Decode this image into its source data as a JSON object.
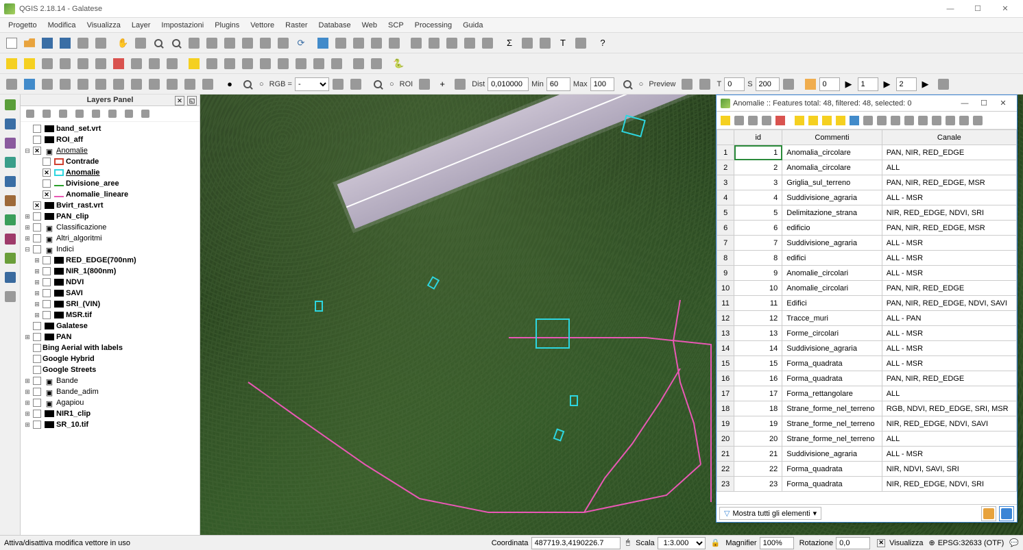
{
  "window": {
    "title": "QGIS 2.18.14 - Galatese"
  },
  "menu": [
    "Progetto",
    "Modifica",
    "Visualizza",
    "Layer",
    "Impostazioni",
    "Plugins",
    "Vettore",
    "Raster",
    "Database",
    "Web",
    "SCP",
    "Processing",
    "Guida"
  ],
  "toolbar3": {
    "rgb_label": "RGB =",
    "rgb_value": "-",
    "roi_label": "ROI",
    "dist_label": "Dist",
    "dist_value": "0,010000",
    "min_label": "Min",
    "min_value": "60",
    "max_label": "Max",
    "max_value": "100",
    "preview_label": "Preview",
    "t_label": "T",
    "t_value": "0",
    "s_label": "S",
    "s_value": "200",
    "grid1_value": "0",
    "grid2_value": "1",
    "grid3_value": "2"
  },
  "layers_panel": {
    "title": "Layers Panel",
    "items": [
      {
        "level": 0,
        "exp": "",
        "checked": false,
        "sym": "#000",
        "label": "band_set.vrt",
        "bold": true
      },
      {
        "level": 0,
        "exp": "",
        "checked": false,
        "sym": "#000",
        "label": "ROI_aff",
        "bold": true
      },
      {
        "level": 0,
        "exp": "-",
        "checked": true,
        "sym": "group",
        "label": "Anomalie",
        "bold": false,
        "under": true
      },
      {
        "level": 1,
        "exp": "",
        "checked": false,
        "sym": "#d04030",
        "label": "Contrade",
        "bold": true,
        "outline": true
      },
      {
        "level": 1,
        "exp": "",
        "checked": true,
        "sym": "#2dd6e0",
        "label": "Anomalie",
        "bold": true,
        "under": true,
        "outline": true
      },
      {
        "level": 1,
        "exp": "",
        "checked": false,
        "sym": "#2aa02a",
        "label": "Divisione_aree",
        "bold": true,
        "line": true
      },
      {
        "level": 1,
        "exp": "",
        "checked": true,
        "sym": "#e958b5",
        "label": "Anomalie_lineare",
        "bold": true,
        "line": true
      },
      {
        "level": 0,
        "exp": "",
        "checked": true,
        "sym": "#000",
        "label": "Bvirt_rast.vrt",
        "bold": true
      },
      {
        "level": 0,
        "exp": "+",
        "checked": false,
        "sym": "#000",
        "label": "PAN_clip",
        "bold": true
      },
      {
        "level": 0,
        "exp": "+",
        "checked": false,
        "sym": "group",
        "label": "Classificazione"
      },
      {
        "level": 0,
        "exp": "+",
        "checked": false,
        "sym": "group",
        "label": "Altri_algoritmi"
      },
      {
        "level": 0,
        "exp": "-",
        "checked": false,
        "sym": "group",
        "label": "Indici"
      },
      {
        "level": 1,
        "exp": "+",
        "checked": false,
        "sym": "#000",
        "label": "RED_EDGE(700nm)",
        "bold": true
      },
      {
        "level": 1,
        "exp": "+",
        "checked": false,
        "sym": "#000",
        "label": "NIR_1(800nm)",
        "bold": true
      },
      {
        "level": 1,
        "exp": "+",
        "checked": false,
        "sym": "#000",
        "label": "NDVI",
        "bold": true
      },
      {
        "level": 1,
        "exp": "+",
        "checked": false,
        "sym": "#000",
        "label": "SAVI",
        "bold": true
      },
      {
        "level": 1,
        "exp": "+",
        "checked": false,
        "sym": "#000",
        "label": "SRI_(VIN)",
        "bold": true
      },
      {
        "level": 1,
        "exp": "+",
        "checked": false,
        "sym": "#000",
        "label": "MSR.tif",
        "bold": true
      },
      {
        "level": 0,
        "exp": "",
        "checked": false,
        "sym": "#000",
        "label": "Galatese",
        "bold": true
      },
      {
        "level": 0,
        "exp": "+",
        "checked": false,
        "sym": "#000",
        "label": "PAN",
        "bold": true
      },
      {
        "level": 0,
        "exp": "",
        "checked": false,
        "sym": "",
        "label": "Bing Aerial with labels",
        "bold": true
      },
      {
        "level": 0,
        "exp": "",
        "checked": false,
        "sym": "",
        "label": "Google Hybrid",
        "bold": true
      },
      {
        "level": 0,
        "exp": "",
        "checked": false,
        "sym": "",
        "label": "Google Streets",
        "bold": true
      },
      {
        "level": 0,
        "exp": "+",
        "checked": false,
        "sym": "group",
        "label": "Bande"
      },
      {
        "level": 0,
        "exp": "+",
        "checked": false,
        "sym": "group",
        "label": "Bande_adim"
      },
      {
        "level": 0,
        "exp": "+",
        "checked": false,
        "sym": "group",
        "label": "Agapiou"
      },
      {
        "level": 0,
        "exp": "+",
        "checked": false,
        "sym": "#000",
        "label": "NIR1_clip",
        "bold": true
      },
      {
        "level": 0,
        "exp": "+",
        "checked": false,
        "sym": "#000",
        "label": "SR_10.tif",
        "bold": true
      }
    ]
  },
  "attr": {
    "title": "Anomalie :: Features total: 48, filtered: 48, selected: 0",
    "columns": [
      "",
      "id",
      "Commenti",
      "Canale"
    ],
    "filter_label": "Mostra tutti gli elementi",
    "rows": [
      {
        "n": 1,
        "id": 1,
        "c": "Anomalia_circolare",
        "k": "PAN, NIR, RED_EDGE"
      },
      {
        "n": 2,
        "id": 2,
        "c": "Anomalia_circolare",
        "k": "ALL"
      },
      {
        "n": 3,
        "id": 3,
        "c": "Griglia_sul_terreno",
        "k": "PAN, NIR, RED_EDGE, MSR"
      },
      {
        "n": 4,
        "id": 4,
        "c": "Suddivisione_agraria",
        "k": "ALL - MSR"
      },
      {
        "n": 5,
        "id": 5,
        "c": "Delimitazione_strana",
        "k": "NIR, RED_EDGE, NDVI, SRI"
      },
      {
        "n": 6,
        "id": 6,
        "c": "edificio",
        "k": "PAN, NIR, RED_EDGE, MSR"
      },
      {
        "n": 7,
        "id": 7,
        "c": "Suddivisione_agraria",
        "k": "ALL - MSR"
      },
      {
        "n": 8,
        "id": 8,
        "c": "edifici",
        "k": "ALL - MSR"
      },
      {
        "n": 9,
        "id": 9,
        "c": "Anomalie_circolari",
        "k": "ALL - MSR"
      },
      {
        "n": 10,
        "id": 10,
        "c": "Anomalie_circolari",
        "k": "PAN, NIR, RED_EDGE"
      },
      {
        "n": 11,
        "id": 11,
        "c": "Edifici",
        "k": "PAN, NIR, RED_EDGE, NDVI, SAVI"
      },
      {
        "n": 12,
        "id": 12,
        "c": "Tracce_muri",
        "k": "ALL - PAN"
      },
      {
        "n": 13,
        "id": 13,
        "c": "Forme_circolari",
        "k": "ALL - MSR"
      },
      {
        "n": 14,
        "id": 14,
        "c": "Suddivisione_agraria",
        "k": "ALL - MSR"
      },
      {
        "n": 15,
        "id": 15,
        "c": "Forma_quadrata",
        "k": "ALL - MSR"
      },
      {
        "n": 16,
        "id": 16,
        "c": "Forma_quadrata",
        "k": "PAN, NIR, RED_EDGE"
      },
      {
        "n": 17,
        "id": 17,
        "c": "Forma_rettangolare",
        "k": "ALL"
      },
      {
        "n": 18,
        "id": 18,
        "c": "Strane_forme_nel_terreno",
        "k": "RGB, NDVI, RED_EDGE, SRI, MSR"
      },
      {
        "n": 19,
        "id": 19,
        "c": "Strane_forme_nel_terreno",
        "k": "NIR, RED_EDGE, NDVI, SAVI"
      },
      {
        "n": 20,
        "id": 20,
        "c": "Strane_forme_nel_terreno",
        "k": "ALL"
      },
      {
        "n": 21,
        "id": 21,
        "c": "Suddivisione_agraria",
        "k": "ALL - MSR"
      },
      {
        "n": 22,
        "id": 22,
        "c": "Forma_quadrata",
        "k": "NIR, NDVI, SAVI, SRI"
      },
      {
        "n": 23,
        "id": 23,
        "c": "Forma_quadrata",
        "k": "NIR, RED_EDGE, NDVI, SRI"
      }
    ]
  },
  "status": {
    "message": "Attiva/disattiva modifica vettore in uso",
    "coord_label": "Coordinata",
    "coord_value": "487719.3,4190226.7",
    "scale_label": "Scala",
    "scale_value": "1:3.000",
    "magnifier_label": "Magnifier",
    "magnifier_value": "100%",
    "rotation_label": "Rotazione",
    "rotation_value": "0,0",
    "render_label": "Visualizza",
    "crs_value": "EPSG:32633 (OTF)"
  }
}
